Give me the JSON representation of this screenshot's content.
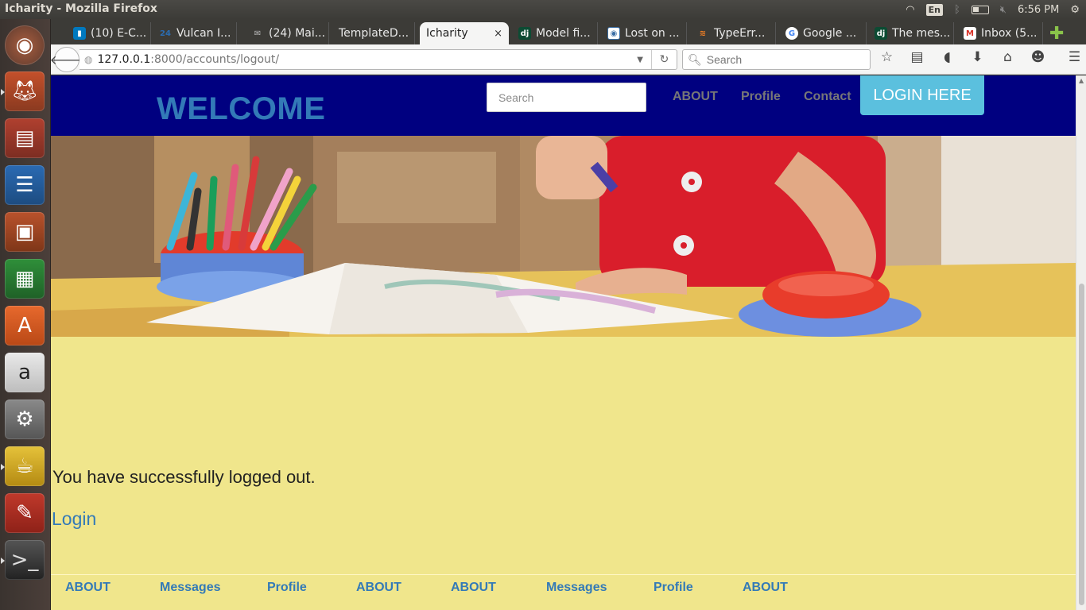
{
  "window": {
    "title": "Icharity - Mozilla Firefox"
  },
  "tray": {
    "keyboard": "En",
    "time": "6:56 PM"
  },
  "tabs": [
    {
      "label": "(10) E-C...",
      "icon": "trello-icon",
      "color": "#0079bf"
    },
    {
      "label": "Vulcan I...",
      "icon": "vulcan-icon",
      "color": "#2b6cb0"
    },
    {
      "label": "(24) Mai...",
      "icon": "mail-icon",
      "color": "#888888"
    },
    {
      "label": "TemplateD...",
      "icon": "",
      "color": ""
    },
    {
      "label": "Icharity",
      "icon": "",
      "color": "",
      "active": true
    },
    {
      "label": "Model fi...",
      "icon": "django-icon",
      "color": "#0c4b33"
    },
    {
      "label": "Lost on ...",
      "icon": "page-icon",
      "color": "#3a6ea5"
    },
    {
      "label": "TypeErr...",
      "icon": "stackoverflow-icon",
      "color": "#f48024"
    },
    {
      "label": "Google ...",
      "icon": "google-icon",
      "color": "#4285f4"
    },
    {
      "label": "The mes...",
      "icon": "django-icon",
      "color": "#0c4b33"
    },
    {
      "label": "Inbox (5...",
      "icon": "gmail-icon",
      "color": "#d93025"
    }
  ],
  "tab_close": "×",
  "url": {
    "host": "127.0.0.1",
    "rest": ":8000/accounts/logout/"
  },
  "browser_search": {
    "placeholder": "Search"
  },
  "site": {
    "brand": "WELCOME",
    "search_placeholder": "Search",
    "nav": [
      "ABOUT",
      "Profile",
      "Contact"
    ],
    "login_button": "LOGIN HERE",
    "header_color": "#000080",
    "page_color": "#f0e68c",
    "link_color": "#337ab7"
  },
  "content": {
    "message": "You have successfully logged out.",
    "login_link": "Login"
  },
  "footer": [
    "ABOUT",
    "Messages",
    "Profile",
    "ABOUT",
    "ABOUT",
    "Messages",
    "Profile",
    "ABOUT"
  ]
}
